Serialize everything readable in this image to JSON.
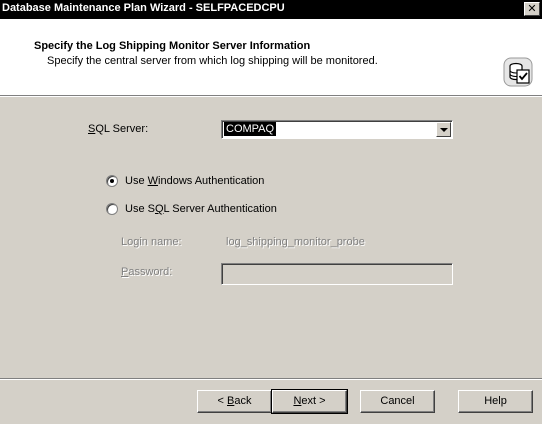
{
  "window": {
    "title": "Database Maintenance Plan Wizard - SELFPACEDCPU",
    "close_glyph": "✕"
  },
  "header": {
    "title": "Specify the Log Shipping Monitor Server Information",
    "subtitle": "Specify the central server from which log shipping will be monitored.",
    "icon": "database-checklist-icon"
  },
  "form": {
    "sql_server": {
      "label_prefix": "",
      "label_accel": "S",
      "label_suffix": "QL Server:",
      "value": "COMPAQ"
    },
    "auth_windows": {
      "prefix": "Use ",
      "accel": "W",
      "suffix": "indows Authentication",
      "checked": true
    },
    "auth_sql": {
      "prefix": "Use S",
      "accel": "Q",
      "suffix": "L Server Authentication",
      "checked": false
    },
    "login_name": {
      "label": "Login name:",
      "value": "log_shipping_monitor_probe"
    },
    "password": {
      "label_accel": "P",
      "label_suffix": "assword:",
      "value": ""
    }
  },
  "buttons": {
    "back": {
      "prefix": "< ",
      "accel": "B",
      "suffix": "ack"
    },
    "next": {
      "prefix": "",
      "accel": "N",
      "suffix": "ext >"
    },
    "cancel": "Cancel",
    "help": "Help"
  }
}
